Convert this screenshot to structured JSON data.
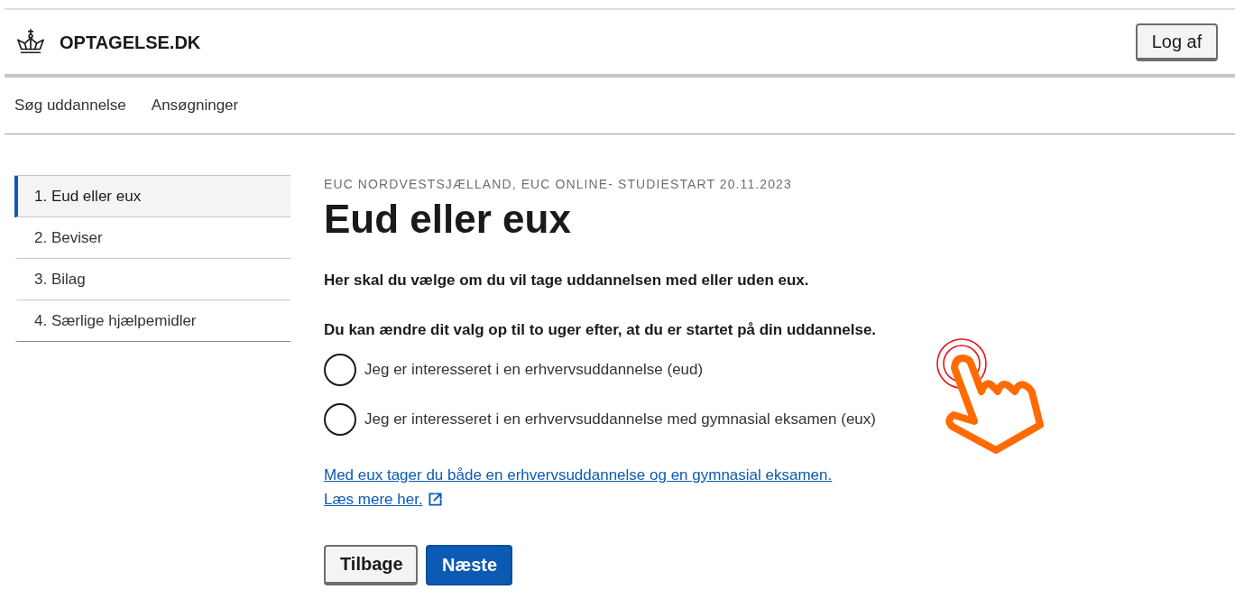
{
  "header": {
    "logo_text": "OPTAGELSE.DK",
    "logout_button": "Log af"
  },
  "nav": {
    "items": [
      "Søg uddannelse",
      "Ansøgninger"
    ]
  },
  "steps": [
    {
      "label": "1. Eud eller eux",
      "selected": true
    },
    {
      "label": "2. Beviser",
      "selected": false
    },
    {
      "label": "3. Bilag",
      "selected": false
    },
    {
      "label": "4. Særlige hjælpemidler",
      "selected": false
    }
  ],
  "main": {
    "eyebrow": "EUC NORDVESTSJÆLLAND, EUC ONLINE- STUDIESTART 20.11.2023",
    "title": "Eud eller eux",
    "paragraphs": [
      "Her skal du vælge om du vil tage uddannelsen med eller uden eux.",
      "Du kan ændre dit valg op til to uger efter, at du er startet på din uddannelse."
    ],
    "options": [
      {
        "label": "Jeg er interesseret i en erhvervsuddannelse (eud)",
        "selected": false
      },
      {
        "label": "Jeg er interesseret i en erhvervsuddannelse med gymnasial eksamen (eux)",
        "selected": false
      }
    ],
    "links": [
      {
        "text": "Med eux tager du både en erhvervsuddannelse og en gymnasial eksamen.",
        "external": false
      },
      {
        "text": "Læs mere her.",
        "external": true
      }
    ],
    "buttons": [
      {
        "label": "Tilbage",
        "kind": "secondary"
      },
      {
        "label": "Næste",
        "kind": "primary"
      }
    ]
  }
}
